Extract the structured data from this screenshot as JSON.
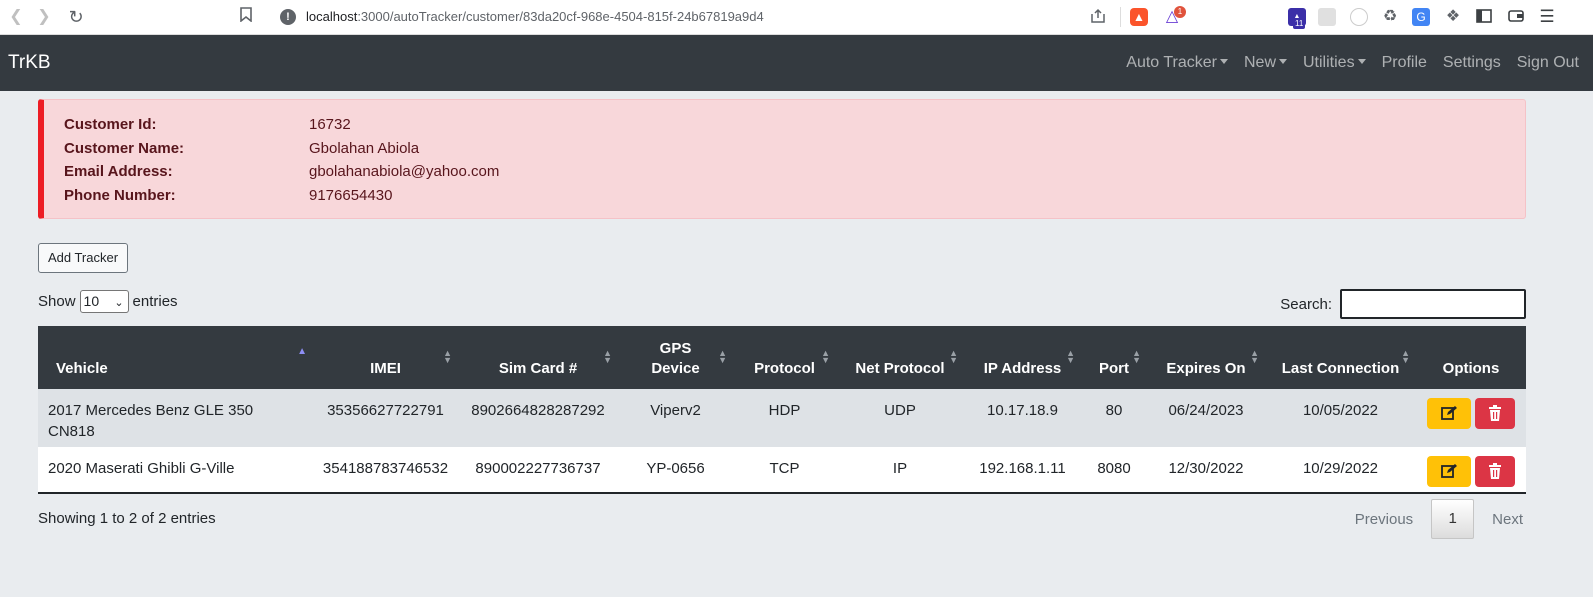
{
  "browser": {
    "url_host": "localhost",
    "url_rest": ":3000/autoTracker/customer/83da20cf-968e-4504-815f-24b67819a9d4",
    "ext_badge": "1",
    "ext_badge2": "11"
  },
  "navbar": {
    "brand": "TrKB",
    "items": [
      {
        "label": "Auto Tracker",
        "dropdown": true
      },
      {
        "label": "New",
        "dropdown": true
      },
      {
        "label": "Utilities",
        "dropdown": true
      },
      {
        "label": "Profile",
        "dropdown": false
      },
      {
        "label": "Settings",
        "dropdown": false
      },
      {
        "label": "Sign Out",
        "dropdown": false
      }
    ]
  },
  "customer": {
    "id_label": "Customer Id:",
    "id_value": "16732",
    "name_label": "Customer Name:",
    "name_value": "Gbolahan Abiola",
    "email_label": "Email Address:",
    "email_value": "gbolahanabiola@yahoo.com",
    "phone_label": "Phone Number:",
    "phone_value": "9176654430"
  },
  "actions": {
    "add_tracker": "Add Tracker"
  },
  "table_controls": {
    "show_label": "Show",
    "entries_value": "10",
    "entries_label": "entries",
    "search_label": "Search:",
    "search_value": ""
  },
  "table": {
    "headers": {
      "vehicle": "Vehicle",
      "imei": "IMEI",
      "sim": "Sim Card #",
      "gps_line1": "GPS",
      "gps_line2": "Device",
      "protocol": "Protocol",
      "net_protocol": "Net Protocol",
      "ip": "IP Address",
      "port": "Port",
      "expires": "Expires On",
      "last": "Last Connection",
      "options": "Options"
    },
    "rows": [
      {
        "vehicle_line1": "2017 Mercedes Benz GLE 350",
        "vehicle_line2": "CN818",
        "imei": "35356627722791",
        "sim": "8902664828287292",
        "gps": "Viperv2",
        "protocol": "HDP",
        "net_protocol": "UDP",
        "ip": "10.17.18.9",
        "port": "80",
        "expires": "06/24/2023",
        "last": "10/05/2022"
      },
      {
        "vehicle_line1": "2020 Maserati Ghibli G-Ville",
        "vehicle_line2": "",
        "imei": "354188783746532",
        "sim": "890002227736737",
        "gps": "YP-0656",
        "protocol": "TCP",
        "net_protocol": "IP",
        "ip": "192.168.1.11",
        "port": "8080",
        "expires": "12/30/2022",
        "last": "10/29/2022"
      }
    ]
  },
  "footer": {
    "showing": "Showing 1 to 2 of 2 entries",
    "previous": "Previous",
    "current_page": "1",
    "next": "Next"
  },
  "colors": {
    "navbar": "#343a40",
    "alert_bg": "#f8d7da",
    "alert_border": "#ed1c24",
    "edit": "#ffc107",
    "delete": "#dc3545"
  }
}
